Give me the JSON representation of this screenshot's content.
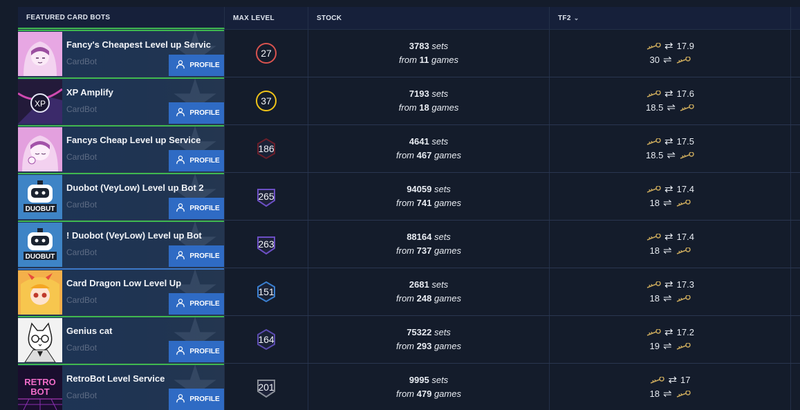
{
  "header": {
    "bots": "FEATURED CARD BOTS",
    "max_level": "MAX LEVEL",
    "stock": "STOCK",
    "tf2": "TF2",
    "tf2_chevron": "chevron-down-icon"
  },
  "rows": [
    {
      "name": "Fancy's Cheapest Level up Servic",
      "type": "CardBot",
      "profile": "PROFILE",
      "level": "27",
      "badge_color": "#d9534f",
      "sets": "3783",
      "sets_unit": "sets",
      "games_prefix": "from",
      "games": "11",
      "games_unit": "games",
      "sell": "17.9",
      "buy": "30",
      "topline": "green"
    },
    {
      "name": "XP Amplify",
      "type": "CardBot",
      "profile": "PROFILE",
      "level": "37",
      "badge_color": "#f0c419",
      "sets": "7193",
      "sets_unit": "sets",
      "games_prefix": "from",
      "games": "18",
      "games_unit": "games",
      "sell": "17.6",
      "buy": "18.5",
      "topline": "green"
    },
    {
      "name": "Fancys Cheap Level up Service",
      "type": "CardBot",
      "profile": "PROFILE",
      "level": "186",
      "badge_color": "#6b1e2a",
      "sets": "4641",
      "sets_unit": "sets",
      "games_prefix": "from",
      "games": "467",
      "games_unit": "games",
      "sell": "17.5",
      "buy": "18.5",
      "topline": "green"
    },
    {
      "name": "Duobot (VeyLow) Level up Bot 2",
      "type": "CardBot",
      "profile": "PROFILE",
      "level": "265",
      "badge_color": "#6c4fc4",
      "sets": "94059",
      "sets_unit": "sets",
      "games_prefix": "from",
      "games": "741",
      "games_unit": "games",
      "sell": "17.4",
      "buy": "18",
      "topline": "green"
    },
    {
      "name": "! Duobot (VeyLow) Level up Bot",
      "type": "CardBot",
      "profile": "PROFILE",
      "level": "263",
      "badge_color": "#6c4fc4",
      "sets": "88164",
      "sets_unit": "sets",
      "games_prefix": "from",
      "games": "737",
      "games_unit": "games",
      "sell": "17.4",
      "buy": "18",
      "topline": "green"
    },
    {
      "name": "Card Dragon Low Level Up",
      "type": "CardBot",
      "profile": "PROFILE",
      "level": "151",
      "badge_color": "#3a7fd0",
      "sets": "2681",
      "sets_unit": "sets",
      "games_prefix": "from",
      "games": "248",
      "games_unit": "games",
      "sell": "17.3",
      "buy": "18",
      "topline": "blue"
    },
    {
      "name": "Genius cat",
      "type": "CardBot",
      "profile": "PROFILE",
      "level": "164",
      "badge_color": "#5b4bb0",
      "sets": "75322",
      "sets_unit": "sets",
      "games_prefix": "from",
      "games": "293",
      "games_unit": "games",
      "sell": "17.2",
      "buy": "19",
      "topline": "green"
    },
    {
      "name": "RetroBot Level Service",
      "type": "CardBot",
      "profile": "PROFILE",
      "level": "201",
      "badge_color": "#8a8f98",
      "sets": "9995",
      "sets_unit": "sets",
      "games_prefix": "from",
      "games": "479",
      "games_unit": "games",
      "sell": "17",
      "buy": "18",
      "topline": "green"
    }
  ]
}
